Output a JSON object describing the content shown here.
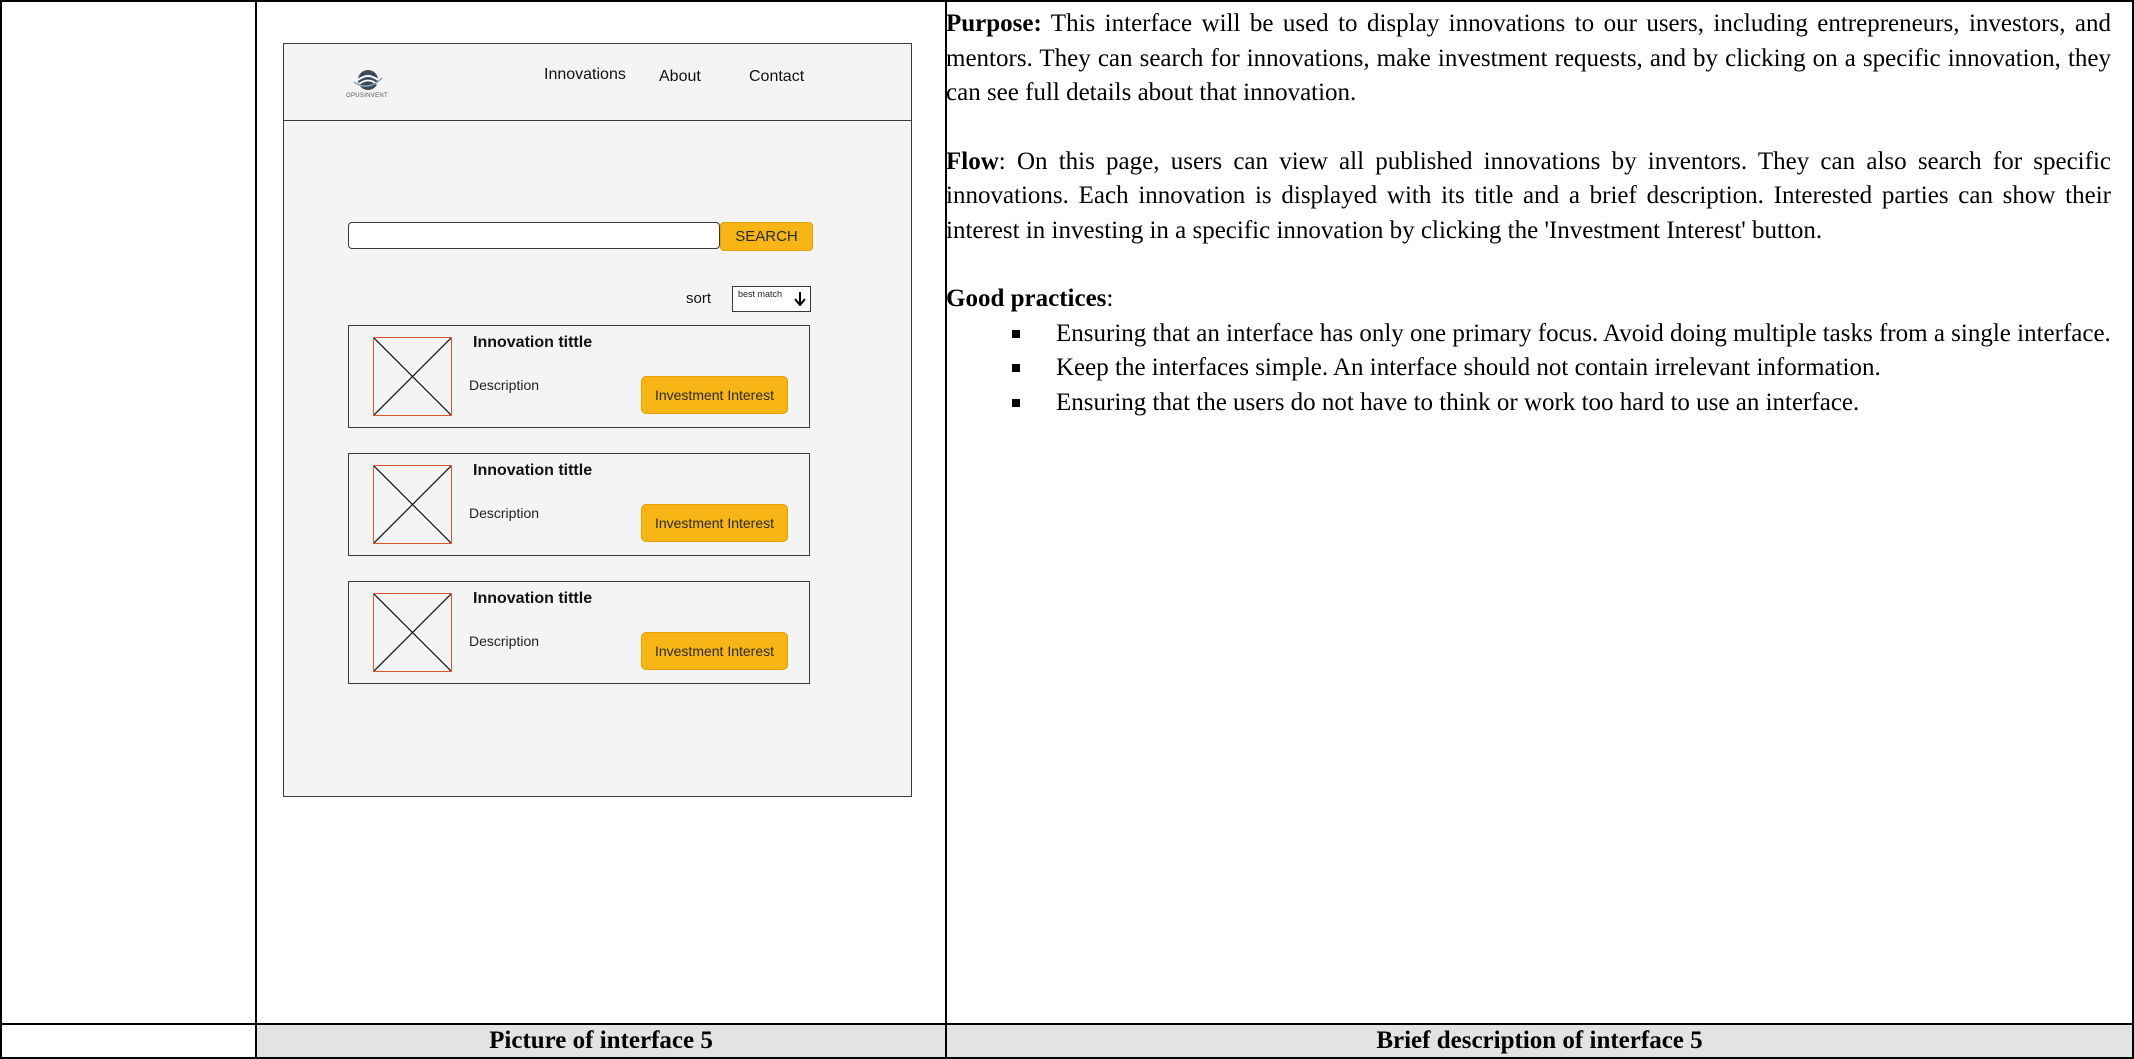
{
  "labels": {
    "picture": "Picture of interface 5",
    "brief": "Brief description of interface 5"
  },
  "mockup": {
    "logo_caption": "OPUSINVENT",
    "nav": [
      "Innovations",
      "About",
      "Contact"
    ],
    "search": {
      "value": "",
      "button": "SEARCH"
    },
    "sort": {
      "label": "sort",
      "selected": "best match"
    },
    "cards": [
      {
        "title": "Innovation tittle",
        "description": "Description",
        "button": "Investment Interest"
      },
      {
        "title": "Innovation tittle",
        "description": "Description",
        "button": "Investment Interest"
      },
      {
        "title": "Innovation tittle",
        "description": "Description",
        "button": "Investment Interest"
      }
    ],
    "colors": {
      "accent": "#f8b616",
      "image_placeholder_border": "#e0542a"
    }
  },
  "description": {
    "purpose_heading": "Purpose:",
    "purpose_text": " This interface will be used to display innovations to our users, including entrepreneurs, investors, and mentors. They can search for innovations, make investment requests, and by clicking on a specific innovation, they can see full details about that innovation.",
    "flow_heading": "Flow",
    "flow_text": ": On this page, users can view all published innovations by inventors. They can also search for specific innovations. Each innovation is displayed with its title and a brief description. Interested parties can show their interest in investing in a specific innovation by clicking the 'Investment Interest' button.",
    "practices_heading": "Good practices",
    "practices_colon": ":",
    "practices": [
      "Ensuring that an interface has only one primary focus. Avoid doing multiple tasks from a single interface.",
      "Keep the interfaces simple. An interface should not contain irrelevant information.",
      "Ensuring that the users do not have to think or work too hard to use an interface."
    ]
  }
}
